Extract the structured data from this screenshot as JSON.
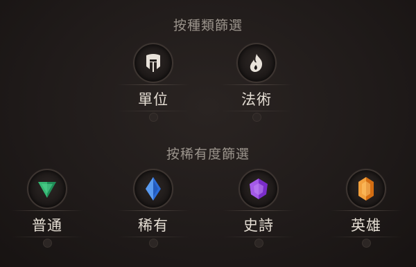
{
  "type_filter": {
    "title": "按種類篩選",
    "buttons": [
      {
        "label": "單位",
        "icon": "helmet-icon"
      },
      {
        "label": "法術",
        "icon": "flame-icon"
      }
    ]
  },
  "rarity_filter": {
    "title": "按稀有度篩選",
    "buttons": [
      {
        "label": "普通",
        "icon": "green-gem-icon",
        "color": "#2ea36a"
      },
      {
        "label": "稀有",
        "icon": "blue-gem-icon",
        "color": "#3d7fe0"
      },
      {
        "label": "史詩",
        "icon": "purple-gem-icon",
        "color": "#8a3ad6"
      },
      {
        "label": "英雄",
        "icon": "orange-gem-icon",
        "color": "#e07d1f"
      }
    ]
  }
}
